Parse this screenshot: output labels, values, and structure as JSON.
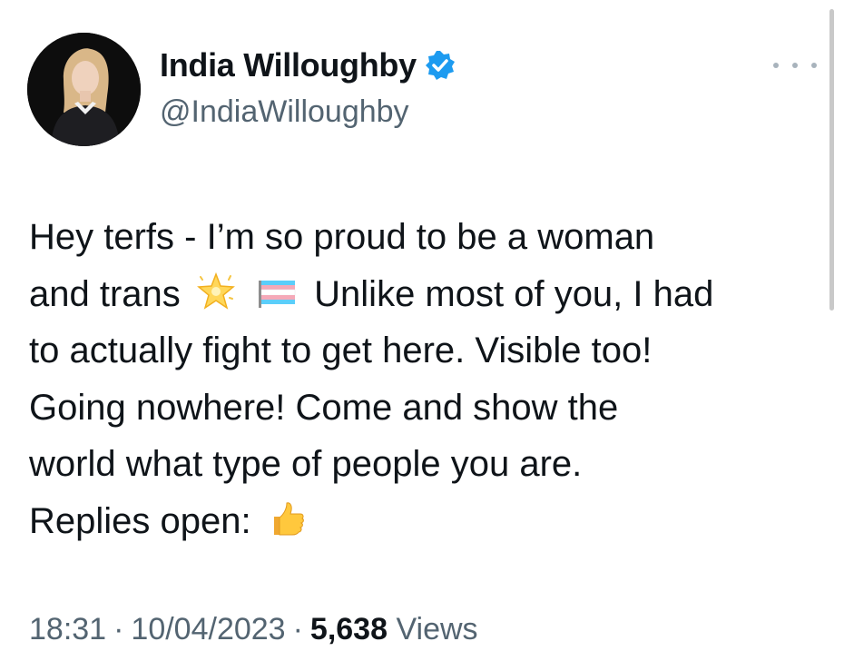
{
  "author": {
    "display_name": "India Willoughby",
    "handle": "@IndiaWilloughby",
    "verified": true
  },
  "tweet": {
    "lines": [
      "Hey terfs - I’m so proud to be a woman",
      {
        "before": "and trans",
        "emojis": [
          "glowing-star-emoji",
          "transgender-flag-emoji"
        ],
        "after": "Unlike most of you, I had"
      },
      "to actually fight to get here. Visible too!",
      "Going nowhere! Come and show the",
      "world what type of people you are.",
      {
        "before": "Replies open:",
        "emojis": [
          "thumbs-up-emoji"
        ],
        "after": ""
      }
    ]
  },
  "meta": {
    "time": "18:31",
    "date": "10/04/2023",
    "views_count": "5,638",
    "views_label": "Views",
    "separator": "·"
  },
  "colors": {
    "text": "#0f1419",
    "secondary": "#536471",
    "verified_badge": "#1d9bf0"
  }
}
